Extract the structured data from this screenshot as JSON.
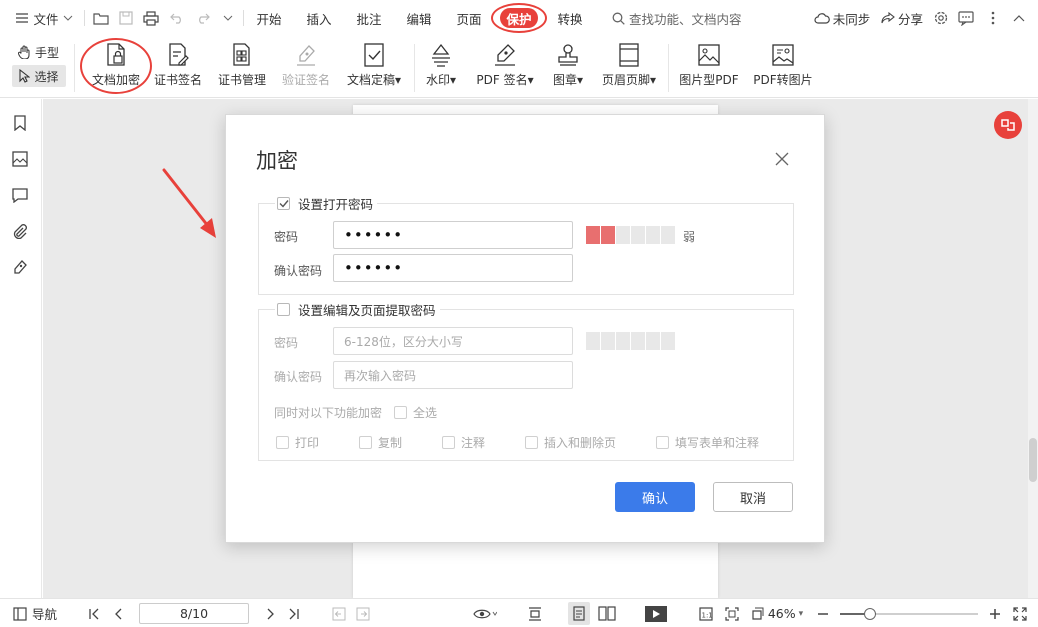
{
  "topbar": {
    "file_menu": "文件",
    "tabs": [
      "开始",
      "插入",
      "批注",
      "编辑",
      "页面",
      "保护",
      "转换"
    ],
    "active_tab": "保护",
    "search_placeholder": "查找功能、文档内容",
    "sync_label": "未同步",
    "share_label": "分享"
  },
  "ribbon": {
    "hand_tool": "手型",
    "select_tool": "选择",
    "buttons": [
      {
        "label": "文档加密",
        "icon": "document-lock-icon"
      },
      {
        "label": "证书签名",
        "icon": "certificate-sign-icon"
      },
      {
        "label": "证书管理",
        "icon": "certificate-manage-icon"
      },
      {
        "label": "验证签名",
        "icon": "verify-signature-icon",
        "disabled": true
      },
      {
        "label": "文档定稿",
        "icon": "document-finalize-icon",
        "dropdown": true
      },
      {
        "label": "水印",
        "icon": "watermark-icon",
        "dropdown": true
      },
      {
        "label": "PDF 签名",
        "icon": "pdf-sign-icon",
        "dropdown": true
      },
      {
        "label": "图章",
        "icon": "stamp-icon",
        "dropdown": true
      },
      {
        "label": "页眉页脚",
        "icon": "header-footer-icon",
        "dropdown": true
      },
      {
        "label": "图片型PDF",
        "icon": "image-pdf-icon"
      },
      {
        "label": "PDF转图片",
        "icon": "pdf-to-image-icon"
      }
    ]
  },
  "dialog": {
    "title": "加密",
    "open_password": {
      "label": "设置打开密码",
      "checked": true,
      "password_label": "密码",
      "password_value": "••••••",
      "confirm_label": "确认密码",
      "confirm_value": "••••••",
      "strength_text": "弱",
      "strength_level": 2
    },
    "edit_password": {
      "label": "设置编辑及页面提取密码",
      "checked": false,
      "password_label": "密码",
      "password_placeholder": "6-128位，区分大小写",
      "confirm_label": "确认密码",
      "confirm_placeholder": "再次输入密码",
      "encrypt_label": "同时对以下功能加密",
      "select_all": "全选",
      "options": [
        "打印",
        "复制",
        "注释",
        "插入和删除页",
        "填写表单和注释"
      ]
    },
    "ok_button": "确认",
    "cancel_button": "取消"
  },
  "statusbar": {
    "nav_label": "导航",
    "page_indicator": "8/10",
    "zoom_level": "46%",
    "zoom_fraction": 0.22
  },
  "colors": {
    "accent_red": "#e8413b",
    "primary_blue": "#3b7bea",
    "strength_red": "#e86f6f"
  }
}
